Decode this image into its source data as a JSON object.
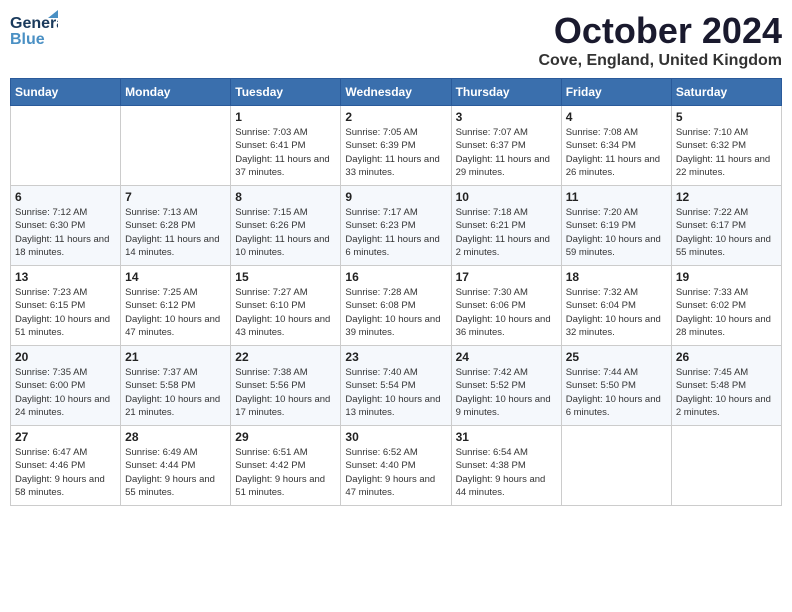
{
  "header": {
    "logo_general": "General",
    "logo_blue": "Blue",
    "month": "October 2024",
    "location": "Cove, England, United Kingdom"
  },
  "days_of_week": [
    "Sunday",
    "Monday",
    "Tuesday",
    "Wednesday",
    "Thursday",
    "Friday",
    "Saturday"
  ],
  "weeks": [
    [
      {
        "day": "",
        "content": ""
      },
      {
        "day": "",
        "content": ""
      },
      {
        "day": "1",
        "content": "Sunrise: 7:03 AM\nSunset: 6:41 PM\nDaylight: 11 hours and 37 minutes."
      },
      {
        "day": "2",
        "content": "Sunrise: 7:05 AM\nSunset: 6:39 PM\nDaylight: 11 hours and 33 minutes."
      },
      {
        "day": "3",
        "content": "Sunrise: 7:07 AM\nSunset: 6:37 PM\nDaylight: 11 hours and 29 minutes."
      },
      {
        "day": "4",
        "content": "Sunrise: 7:08 AM\nSunset: 6:34 PM\nDaylight: 11 hours and 26 minutes."
      },
      {
        "day": "5",
        "content": "Sunrise: 7:10 AM\nSunset: 6:32 PM\nDaylight: 11 hours and 22 minutes."
      }
    ],
    [
      {
        "day": "6",
        "content": "Sunrise: 7:12 AM\nSunset: 6:30 PM\nDaylight: 11 hours and 18 minutes."
      },
      {
        "day": "7",
        "content": "Sunrise: 7:13 AM\nSunset: 6:28 PM\nDaylight: 11 hours and 14 minutes."
      },
      {
        "day": "8",
        "content": "Sunrise: 7:15 AM\nSunset: 6:26 PM\nDaylight: 11 hours and 10 minutes."
      },
      {
        "day": "9",
        "content": "Sunrise: 7:17 AM\nSunset: 6:23 PM\nDaylight: 11 hours and 6 minutes."
      },
      {
        "day": "10",
        "content": "Sunrise: 7:18 AM\nSunset: 6:21 PM\nDaylight: 11 hours and 2 minutes."
      },
      {
        "day": "11",
        "content": "Sunrise: 7:20 AM\nSunset: 6:19 PM\nDaylight: 10 hours and 59 minutes."
      },
      {
        "day": "12",
        "content": "Sunrise: 7:22 AM\nSunset: 6:17 PM\nDaylight: 10 hours and 55 minutes."
      }
    ],
    [
      {
        "day": "13",
        "content": "Sunrise: 7:23 AM\nSunset: 6:15 PM\nDaylight: 10 hours and 51 minutes."
      },
      {
        "day": "14",
        "content": "Sunrise: 7:25 AM\nSunset: 6:12 PM\nDaylight: 10 hours and 47 minutes."
      },
      {
        "day": "15",
        "content": "Sunrise: 7:27 AM\nSunset: 6:10 PM\nDaylight: 10 hours and 43 minutes."
      },
      {
        "day": "16",
        "content": "Sunrise: 7:28 AM\nSunset: 6:08 PM\nDaylight: 10 hours and 39 minutes."
      },
      {
        "day": "17",
        "content": "Sunrise: 7:30 AM\nSunset: 6:06 PM\nDaylight: 10 hours and 36 minutes."
      },
      {
        "day": "18",
        "content": "Sunrise: 7:32 AM\nSunset: 6:04 PM\nDaylight: 10 hours and 32 minutes."
      },
      {
        "day": "19",
        "content": "Sunrise: 7:33 AM\nSunset: 6:02 PM\nDaylight: 10 hours and 28 minutes."
      }
    ],
    [
      {
        "day": "20",
        "content": "Sunrise: 7:35 AM\nSunset: 6:00 PM\nDaylight: 10 hours and 24 minutes."
      },
      {
        "day": "21",
        "content": "Sunrise: 7:37 AM\nSunset: 5:58 PM\nDaylight: 10 hours and 21 minutes."
      },
      {
        "day": "22",
        "content": "Sunrise: 7:38 AM\nSunset: 5:56 PM\nDaylight: 10 hours and 17 minutes."
      },
      {
        "day": "23",
        "content": "Sunrise: 7:40 AM\nSunset: 5:54 PM\nDaylight: 10 hours and 13 minutes."
      },
      {
        "day": "24",
        "content": "Sunrise: 7:42 AM\nSunset: 5:52 PM\nDaylight: 10 hours and 9 minutes."
      },
      {
        "day": "25",
        "content": "Sunrise: 7:44 AM\nSunset: 5:50 PM\nDaylight: 10 hours and 6 minutes."
      },
      {
        "day": "26",
        "content": "Sunrise: 7:45 AM\nSunset: 5:48 PM\nDaylight: 10 hours and 2 minutes."
      }
    ],
    [
      {
        "day": "27",
        "content": "Sunrise: 6:47 AM\nSunset: 4:46 PM\nDaylight: 9 hours and 58 minutes."
      },
      {
        "day": "28",
        "content": "Sunrise: 6:49 AM\nSunset: 4:44 PM\nDaylight: 9 hours and 55 minutes."
      },
      {
        "day": "29",
        "content": "Sunrise: 6:51 AM\nSunset: 4:42 PM\nDaylight: 9 hours and 51 minutes."
      },
      {
        "day": "30",
        "content": "Sunrise: 6:52 AM\nSunset: 4:40 PM\nDaylight: 9 hours and 47 minutes."
      },
      {
        "day": "31",
        "content": "Sunrise: 6:54 AM\nSunset: 4:38 PM\nDaylight: 9 hours and 44 minutes."
      },
      {
        "day": "",
        "content": ""
      },
      {
        "day": "",
        "content": ""
      }
    ]
  ]
}
